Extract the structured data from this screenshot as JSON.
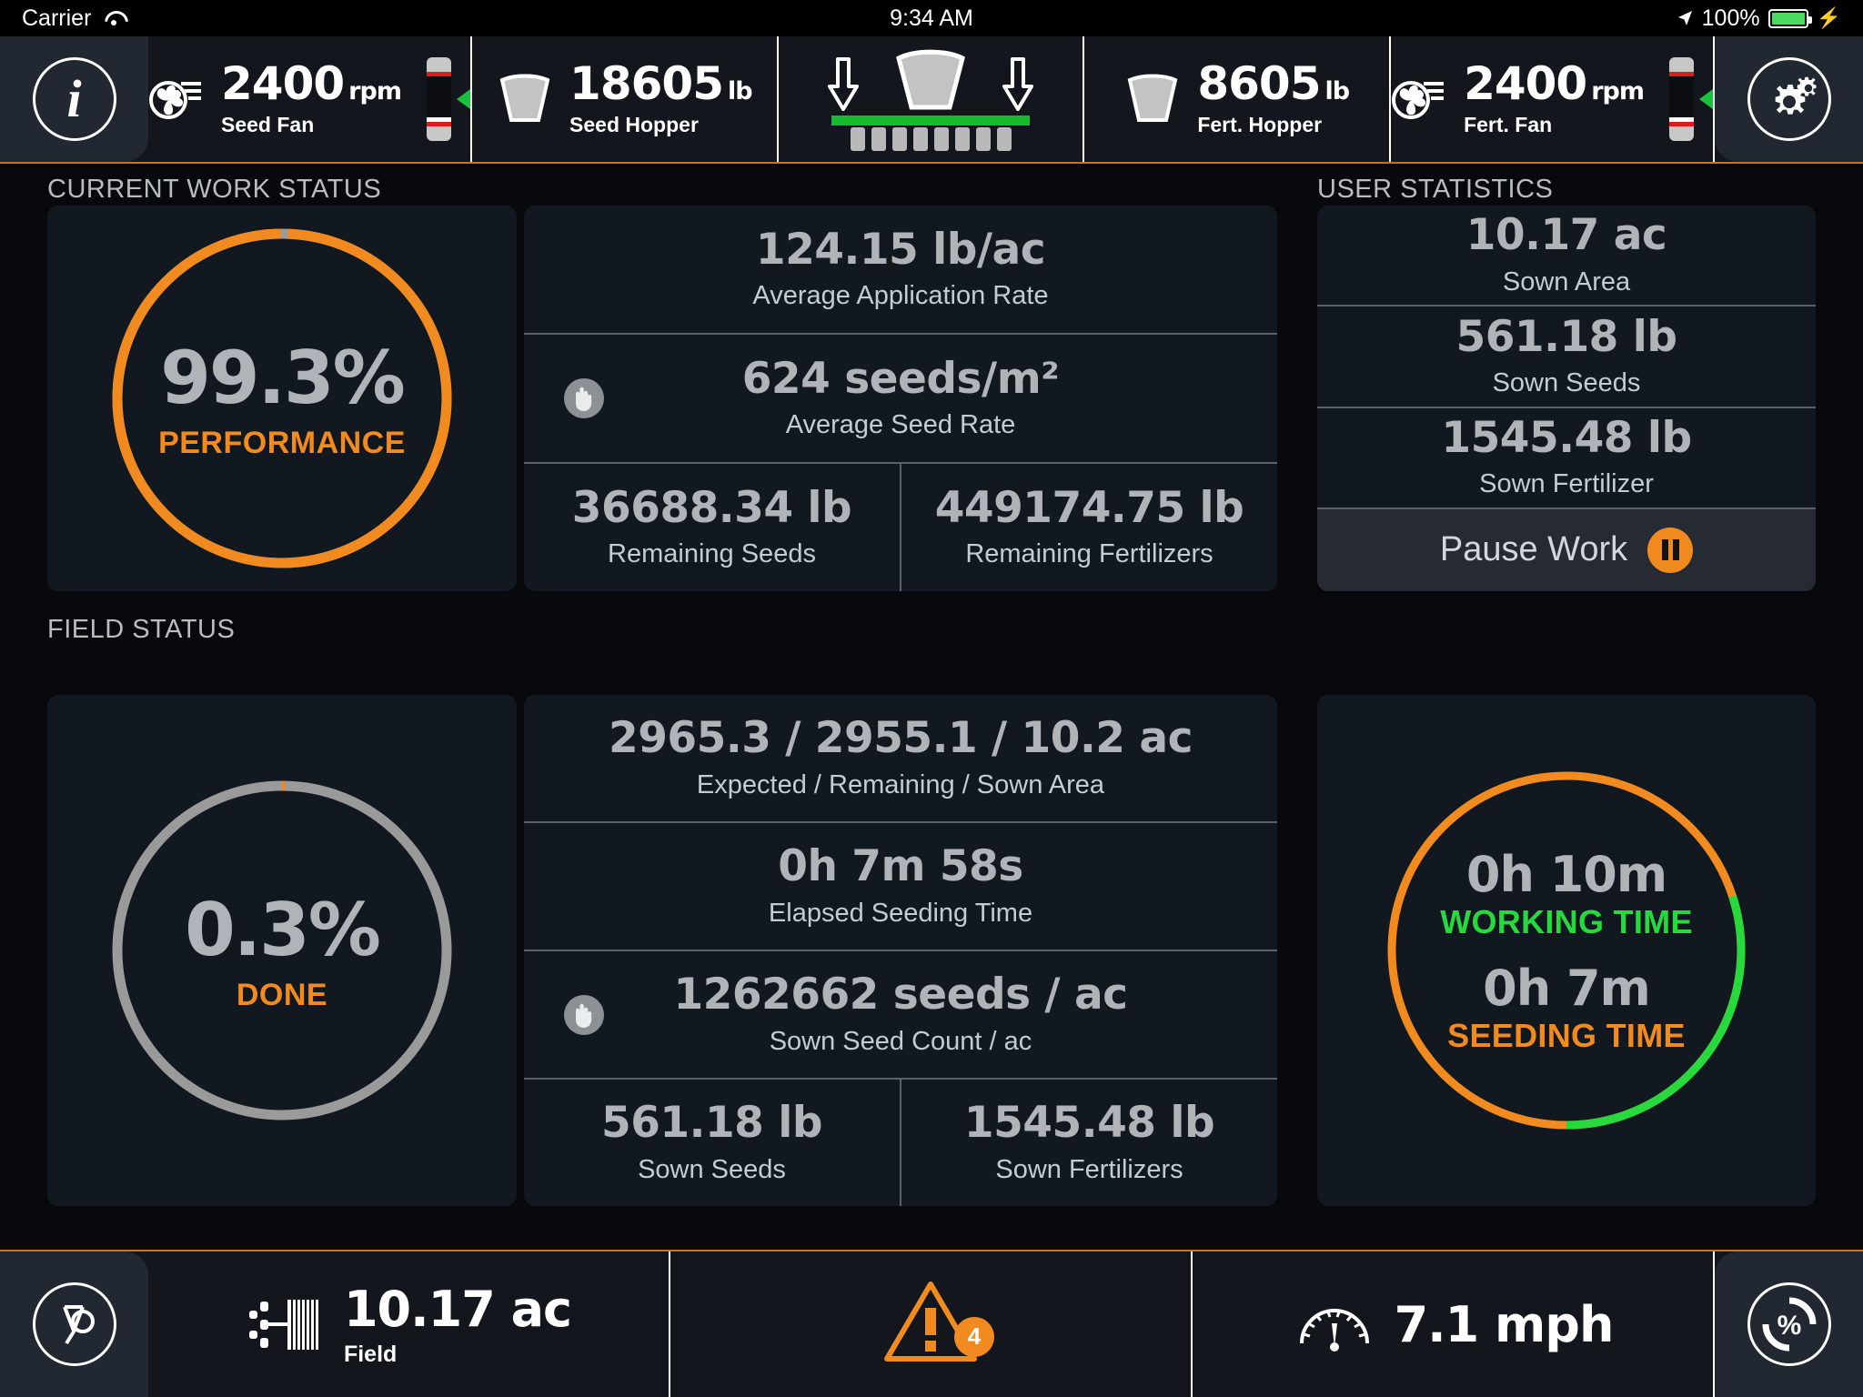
{
  "status_bar": {
    "carrier": "Carrier",
    "wifi_icon": "wifi-icon",
    "time": "9:34 AM",
    "location_icon": "location-arrow-icon",
    "battery_percent": "100%",
    "charging_icon": "lightning-bolt-icon"
  },
  "top_bar": {
    "info_button": {
      "icon": "info-icon",
      "label": "i"
    },
    "settings_button": {
      "icon": "gears-icon"
    },
    "cells": [
      {
        "icon": "fan-icon",
        "value": "2400",
        "unit": "rpm",
        "label": "Seed Fan",
        "gauge": "vertical-gauge"
      },
      {
        "icon": "hopper-icon",
        "value": "18605",
        "unit": "lb",
        "label": "Seed Hopper"
      },
      {
        "icon": "seeding-bar-icon",
        "value": "",
        "unit": "",
        "label": ""
      },
      {
        "icon": "hopper-icon",
        "value": "8605",
        "unit": "lb",
        "label": "Fert. Hopper"
      },
      {
        "icon": "fan-icon",
        "value": "2400",
        "unit": "rpm",
        "label": "Fert. Fan",
        "gauge": "vertical-gauge"
      }
    ]
  },
  "current_work_status": {
    "title": "CURRENT WORK STATUS",
    "performance": {
      "value": "99.3%",
      "label": "PERFORMANCE",
      "percent": 99.3
    },
    "rows": [
      {
        "value": "124.15 lb/ac",
        "label": "Average Application Rate",
        "has_hand_icon": false
      },
      {
        "value": "624 seeds/m²",
        "label": "Average Seed Rate",
        "has_hand_icon": true
      }
    ],
    "split_row": [
      {
        "value": "36688.34 lb",
        "label": "Remaining Seeds"
      },
      {
        "value": "449174.75 lb",
        "label": "Remaining Fertilizers"
      }
    ]
  },
  "field_status": {
    "title": "FIELD STATUS",
    "done": {
      "value": "0.3%",
      "label": "DONE",
      "percent": 0.3
    },
    "rows": [
      {
        "value": "2965.3 / 2955.1 / 10.2 ac",
        "label": "Expected / Remaining / Sown Area",
        "has_hand_icon": false
      },
      {
        "value": "0h 7m 58s",
        "label": "Elapsed Seeding Time",
        "has_hand_icon": false
      },
      {
        "value": "1262662 seeds / ac",
        "label": "Sown Seed Count / ac",
        "has_hand_icon": true
      }
    ],
    "split_row": [
      {
        "value": "561.18 lb",
        "label": "Sown Seeds"
      },
      {
        "value": "1545.48 lb",
        "label": "Sown Fertilizers"
      }
    ]
  },
  "user_statistics": {
    "title": "USER STATISTICS",
    "rows": [
      {
        "value": "10.17 ac",
        "label": "Sown Area"
      },
      {
        "value": "561.18 lb",
        "label": "Sown Seeds"
      },
      {
        "value": "1545.48 lb",
        "label": "Sown Fertilizer"
      }
    ],
    "pause_button": {
      "label": "Pause Work",
      "icon": "pause-icon"
    },
    "time_ring": {
      "working_time_value": "0h 10m",
      "working_time_label": "WORKING TIME",
      "seeding_time_value": "0h 7m",
      "seeding_time_label": "SEEDING TIME",
      "working_fraction": 0.3
    }
  },
  "bottom_bar": {
    "left_button": {
      "icon": "headland-icon"
    },
    "right_button": {
      "icon": "percent-circle-icon"
    },
    "cells": [
      {
        "icon": "implement-icon",
        "value": "10.17 ac",
        "label": "Field"
      },
      {
        "icon": "warning-triangle-icon",
        "badge": "4",
        "value": "",
        "label": ""
      },
      {
        "icon": "speedometer-icon",
        "value": "7.1 mph",
        "label": ""
      }
    ]
  },
  "colors": {
    "accent_orange": "#f18b1f",
    "accent_green": "#27d93d",
    "gray_value": "#b0b4b8",
    "panel_bg": "#121820",
    "bar_bg": "#13161c"
  }
}
